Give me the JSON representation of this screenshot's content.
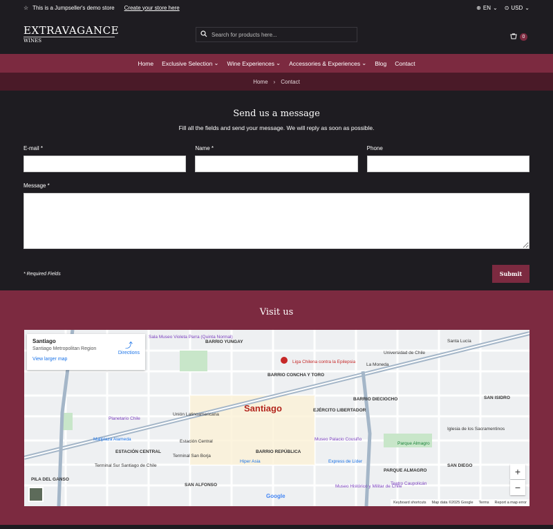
{
  "topbar": {
    "demo_text": "This is a Jumpseller's demo store",
    "create_link": "Create your store here",
    "language": "EN",
    "currency": "USD"
  },
  "header": {
    "brand": "EXTRAVAGANCE",
    "brand_sub": "WINES",
    "search_placeholder": "Search for products here...",
    "cart_count": "0"
  },
  "nav": {
    "items": [
      {
        "label": "Home"
      },
      {
        "label": "Exclusive Selection"
      },
      {
        "label": "Wine Experiences"
      },
      {
        "label": "Accessories & Experiences"
      },
      {
        "label": "Blog"
      },
      {
        "label": "Contact"
      }
    ]
  },
  "breadcrumb": {
    "home": "Home",
    "current": "Contact"
  },
  "form": {
    "title": "Send us a message",
    "subtitle": "Fill all the fields and send your message. We will reply as soon as possible.",
    "email_label": "E-mail *",
    "name_label": "Name *",
    "phone_label": "Phone",
    "message_label": "Message *",
    "required_note": "* Required Fields",
    "submit_label": "Submit"
  },
  "visit": {
    "title": "Visit us",
    "map": {
      "place_title": "Santiago",
      "place_subtitle": "Santiago Metropolitan Region",
      "larger_map": "View larger map",
      "directions": "Directions",
      "city_label": "Santiago",
      "google": "Google",
      "footer": [
        "Keyboard shortcuts",
        "Map data ©2025 Google",
        "Terms",
        "Report a map error"
      ],
      "labels": [
        "BARRIO YUNGAY",
        "BARRIO CONCHA Y TORO",
        "EJÉRCITO LIBERTADOR",
        "BARRIO DIECIOCHO",
        "SAN ISIDRO",
        "ESTACIÓN CENTRAL",
        "BARRIO REPÚBLICA",
        "SAN DIEGO",
        "PARQUE ALMAGRO",
        "PILA DEL GANSO",
        "SAN ALFONSO",
        "Planetario Chile",
        "Mallplaza Alameda",
        "Museo Palacio Cousiño",
        "Hiper Asia",
        "Unión Latinoamericana",
        "Estación Central",
        "Terminal San Borja",
        "Santa Lucía",
        "Universidad de Chile",
        "La Moneda",
        "Liga Chilena contra la Epilepsia",
        "Sala Museo Violeta Parra (Quinta Normal)",
        "Parque Almagro",
        "Iglesia de los Sacramentinos",
        "Express de Líder",
        "Teatro Caupolicán",
        "Museo Histórico y Militar de Chile",
        "Terminal Sur Santiago de Chile"
      ]
    }
  },
  "colors": {
    "accent": "#7c2a40",
    "dark": "#1e1c21",
    "breadcrumb_bg": "#4a1a28"
  }
}
